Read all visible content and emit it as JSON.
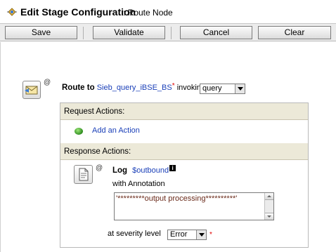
{
  "header": {
    "title": "Edit Stage Configuration",
    "subtitle": ": Route Node",
    "icon": "stage-config-icon"
  },
  "toolbar": {
    "save_label": "Save",
    "validate_label": "Validate",
    "cancel_label": "Cancel",
    "clear_label": "Clear"
  },
  "route": {
    "icon": "route-envelope-icon",
    "at_symbol": "@",
    "keyword": "Route to",
    "service": "Sieb_query_iBSE_BS",
    "required_mark": "*",
    "invoking_label": "invoking",
    "operation": "query"
  },
  "request": {
    "header": "Request Actions:",
    "add_action": "Add an Action"
  },
  "response": {
    "header": "Response Actions:",
    "log": {
      "icon": "log-document-icon",
      "at_symbol": "@",
      "keyword": "Log",
      "variable": "$outbound",
      "info_icon": "info-icon",
      "annotation_label": "with Annotation",
      "annotation_value": "'*********output processing**********'",
      "severity_label": "at severity level",
      "severity_value": "Error",
      "required_mark": "*"
    }
  },
  "colors": {
    "link": "#1a3fb8",
    "section_header_bg": "#ece9d8",
    "required": "#e00000",
    "toolbar_bg": "#ececec"
  }
}
